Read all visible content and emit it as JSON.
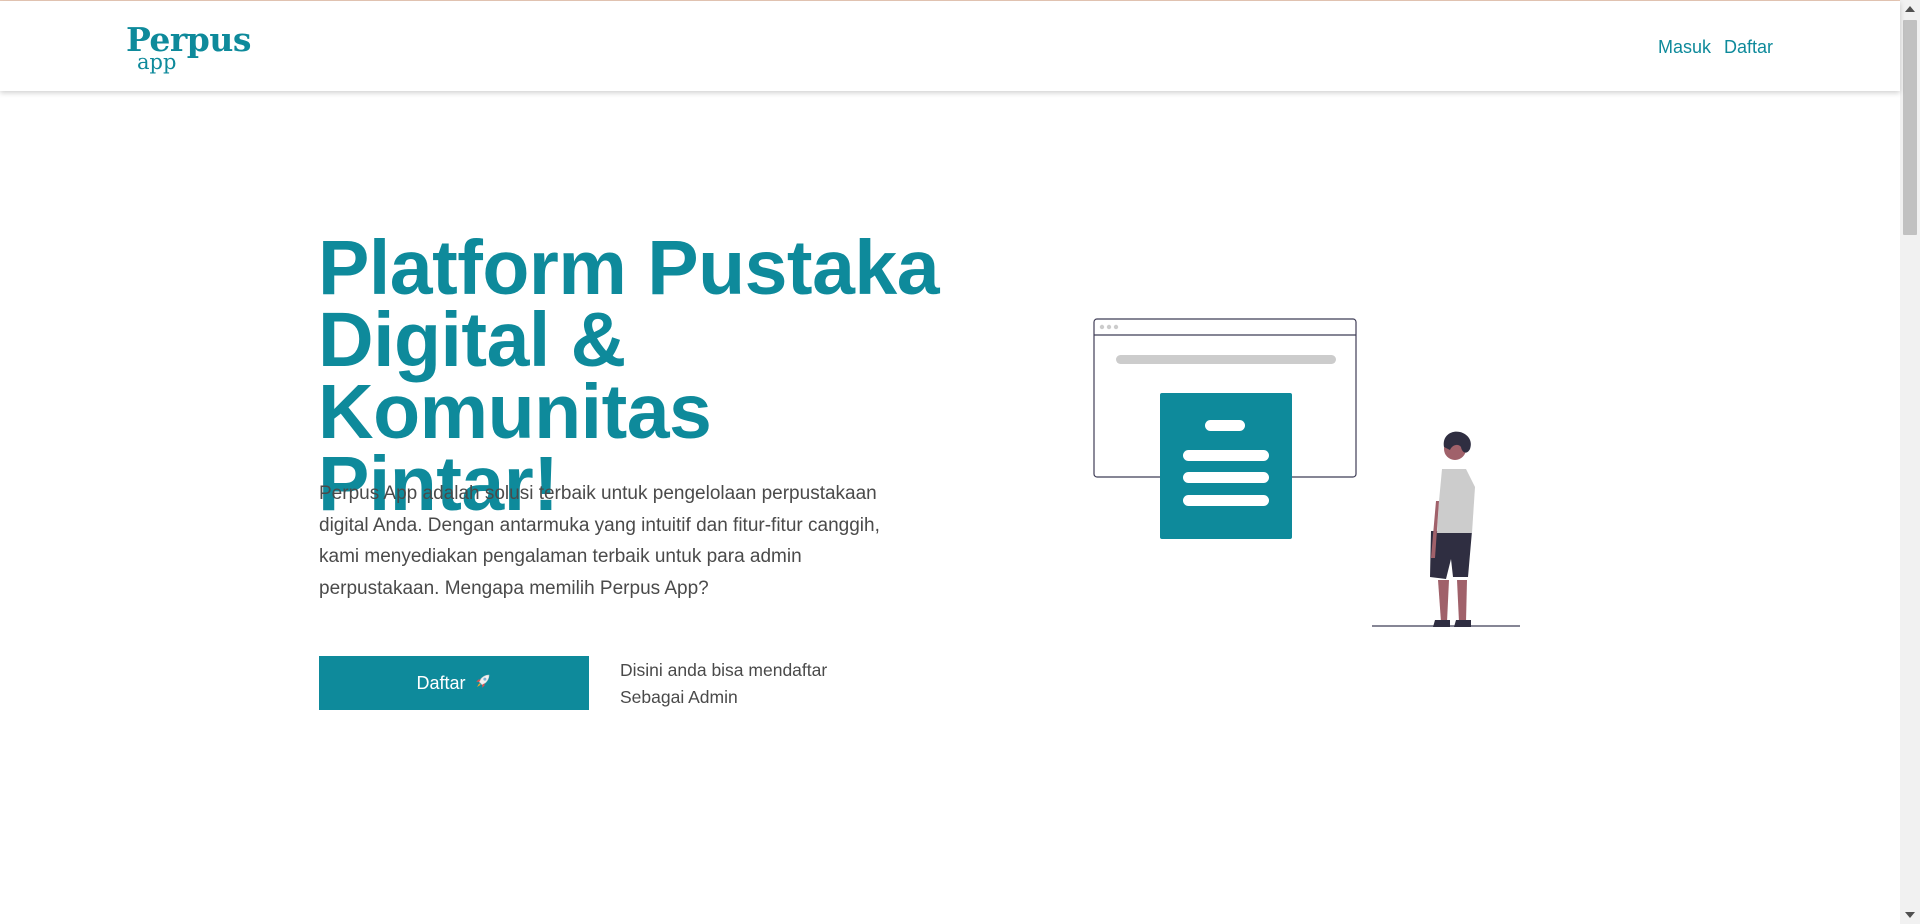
{
  "navbar": {
    "logo_main": "Perpus",
    "logo_sub": "app",
    "links": [
      {
        "label": "Masuk"
      },
      {
        "label": "Daftar"
      }
    ]
  },
  "hero": {
    "title_lines": [
      "Platform Pustaka",
      "Digital & Komunitas",
      "Pintar!"
    ],
    "description": "Perpus App adalah solusi terbaik untuk pengelolaan perpustakaan digital Anda. Dengan antarmuka yang intuitif dan fitur-fitur canggih, kami menyediakan pengalaman terbaik untuk para admin perpustakaan. Mengapa memilih Perpus App?",
    "cta_label": "Daftar",
    "cta_icon": "rocket-icon",
    "note_lines": [
      "Disini anda bisa mendaftar",
      "Sebagai Admin"
    ]
  },
  "colors": {
    "brand": "#0e8a9b",
    "text": "#4a4a4a",
    "background": "#ffffff"
  }
}
